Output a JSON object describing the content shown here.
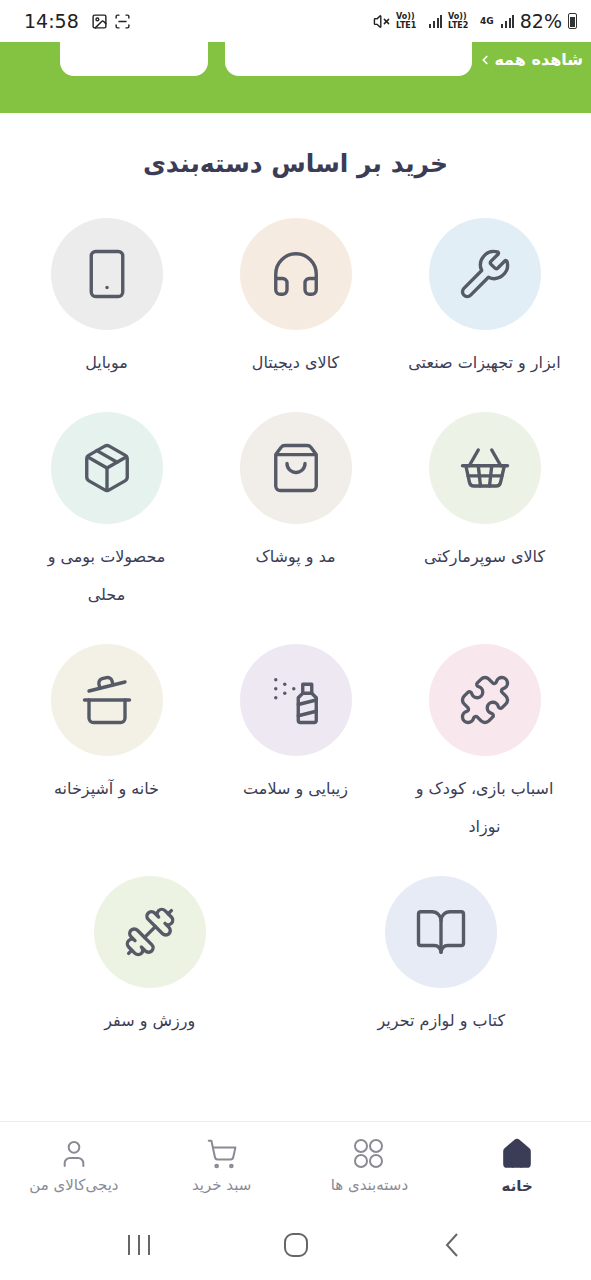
{
  "status_bar": {
    "time": "14:58",
    "sim1": "Vo)) LTE1",
    "sim2": "Vo)) LTE2",
    "network": "4G",
    "battery": "82%",
    "battery_level": 0.82
  },
  "banner": {
    "link": "شاهده همه"
  },
  "section": {
    "title": "خرید بر اساس دسته‌بندی"
  },
  "categories": [
    {
      "label": "ابزار و تجهیزات صنعتی",
      "color": "#e2eef5"
    },
    {
      "label": "کالای دیجیتال",
      "color": "#f6ebe1"
    },
    {
      "label": "موبایل",
      "color": "#ececec"
    },
    {
      "label": "کالای سوپرمارکتی",
      "color": "#edf2e6"
    },
    {
      "label": "مد و پوشاک",
      "color": "#f1ede8"
    },
    {
      "label": "محصولات بومی و محلی",
      "color": "#e6f2ee"
    },
    {
      "label": "اسباب بازی، کودک و نوزاد",
      "color": "#f8e8ed"
    },
    {
      "label": "زیبایی و سلامت",
      "color": "#eee8f3"
    },
    {
      "label": "خانه و آشپزخانه",
      "color": "#f3f1e5"
    },
    {
      "label": "کتاب و لوازم تحریر",
      "color": "#e6ebf5"
    },
    {
      "label": "ورزش و سفر",
      "color": "#edf3e2"
    }
  ],
  "bottom_nav": [
    {
      "label": "خانه",
      "selected": true
    },
    {
      "label": "دسته‌بندی ها",
      "selected": false
    },
    {
      "label": "سبد خرید",
      "selected": false
    },
    {
      "label": "دیجی‌کالای من",
      "selected": false
    }
  ]
}
